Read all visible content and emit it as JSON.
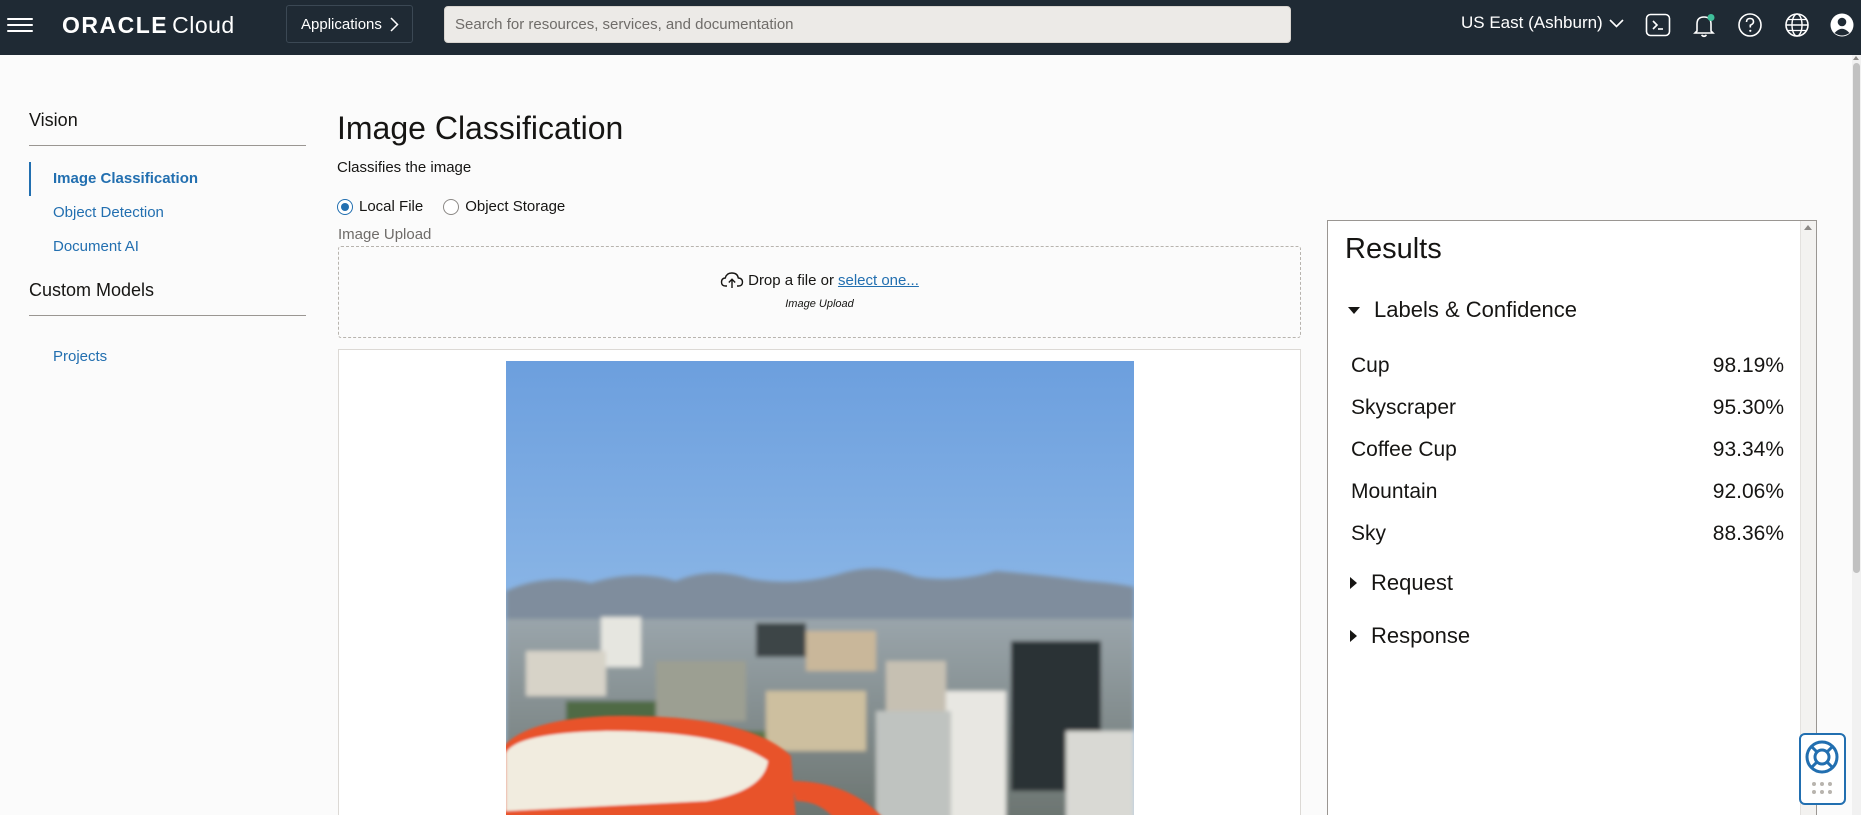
{
  "header": {
    "brand_oracle": "ORACLE",
    "brand_cloud": "Cloud",
    "applications_label": "Applications",
    "search_placeholder": "Search for resources, services, and documentation",
    "region": "US East (Ashburn)",
    "icons": [
      "menu-icon",
      "cloud-shell-icon",
      "bell-icon",
      "help-icon",
      "globe-icon",
      "user-icon"
    ]
  },
  "sidebar": {
    "heading": "Vision",
    "items": [
      {
        "label": "Image Classification",
        "active": true
      },
      {
        "label": "Object Detection",
        "active": false
      },
      {
        "label": "Document AI",
        "active": false
      }
    ],
    "heading2": "Custom Models",
    "items2": [
      {
        "label": "Projects"
      }
    ]
  },
  "main": {
    "title": "Image Classification",
    "subtitle": "Classifies the image",
    "source_options": [
      {
        "label": "Local File",
        "checked": true
      },
      {
        "label": "Object Storage",
        "checked": false
      }
    ],
    "upload_label": "Image Upload",
    "drop_text": "Drop a file or",
    "drop_link": "select one...",
    "drop_caption": "Image Upload"
  },
  "results": {
    "title": "Results",
    "labels_section": "Labels & Confidence",
    "labels": [
      {
        "name": "Cup",
        "confidence": "98.19%"
      },
      {
        "name": "Skyscraper",
        "confidence": "95.30%"
      },
      {
        "name": "Coffee Cup",
        "confidence": "93.34%"
      },
      {
        "name": "Mountain",
        "confidence": "92.06%"
      },
      {
        "name": "Sky",
        "confidence": "88.36%"
      }
    ],
    "request_section": "Request",
    "response_section": "Response"
  },
  "colors": {
    "header_bg": "#1f2a34",
    "link": "#226fb0",
    "cup_orange": "#e8532b"
  }
}
